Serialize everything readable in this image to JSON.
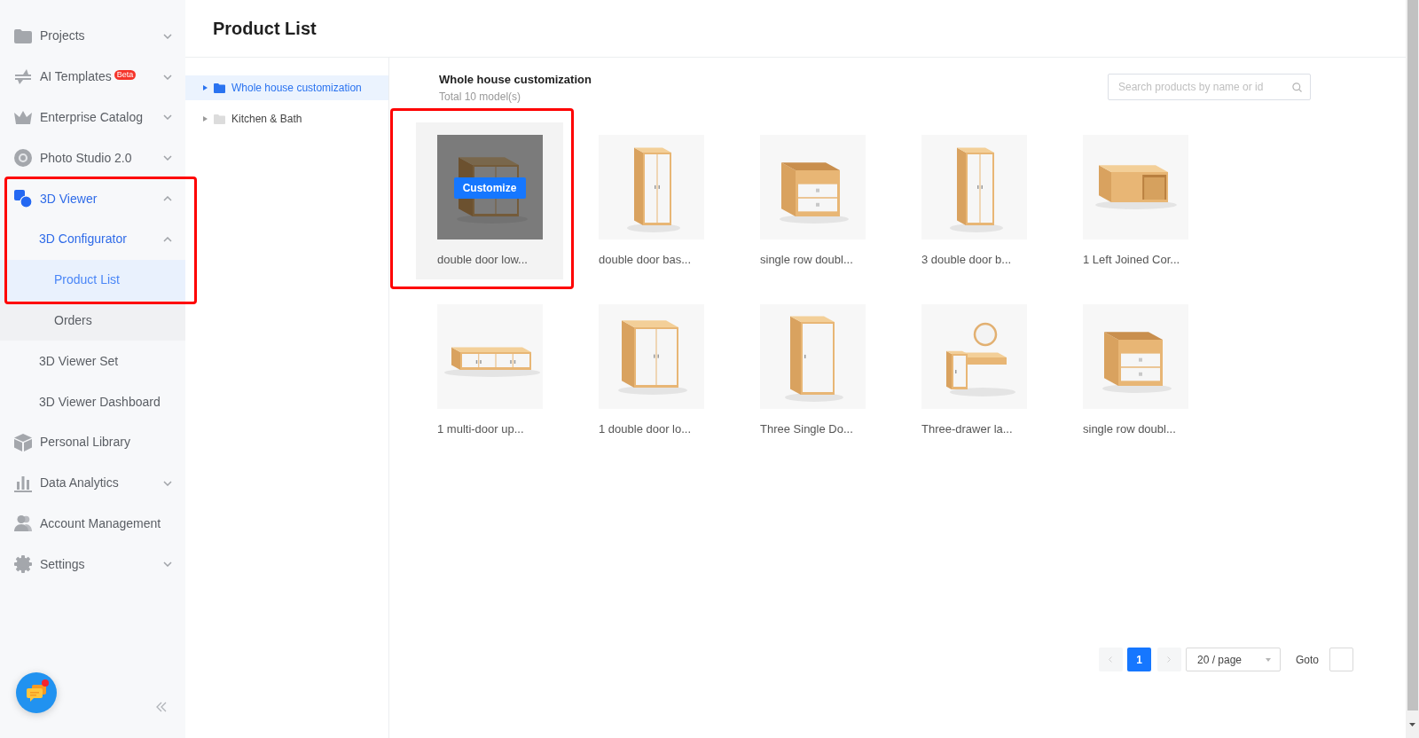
{
  "sidebar": {
    "items": [
      {
        "label": "Projects",
        "expanded": false,
        "selected": false,
        "annotated": false
      },
      {
        "label": "AI Templates",
        "badge": "Beta",
        "expanded": false,
        "selected": false,
        "annotated": false
      },
      {
        "label": "Enterprise Catalog",
        "expanded": false,
        "selected": false,
        "annotated": false
      },
      {
        "label": "Photo Studio 2.0",
        "expanded": false,
        "selected": false,
        "annotated": false
      },
      {
        "label": "3D Viewer",
        "expanded": true,
        "selected": false,
        "annotated": true,
        "children": [
          {
            "label": "3D Configurator",
            "expanded": true,
            "selected": false,
            "annotated": true,
            "children": [
              {
                "label": "Product List",
                "selected": true,
                "annotated": true
              },
              {
                "label": "Orders",
                "selected": false,
                "annotated": false
              }
            ]
          },
          {
            "label": "3D Viewer Set",
            "selected": false,
            "annotated": false
          },
          {
            "label": "3D Viewer Dashboard",
            "selected": false,
            "annotated": false
          }
        ]
      },
      {
        "label": "Personal Library",
        "selected": false,
        "annotated": false
      },
      {
        "label": "Data Analytics",
        "expanded": false,
        "selected": false,
        "annotated": false
      },
      {
        "label": "Account Management",
        "selected": false,
        "annotated": false
      },
      {
        "label": "Settings",
        "expanded": false,
        "selected": false,
        "annotated": false
      }
    ]
  },
  "header": {
    "title": "Product List"
  },
  "category_tree": [
    {
      "label": "Whole house customization",
      "selected": true
    },
    {
      "label": "Kitchen & Bath",
      "selected": false
    }
  ],
  "products": {
    "title": "Whole house customization",
    "count": "Total 10 model(s)",
    "search": {
      "placeholder": "Search products by name or id"
    },
    "items": [
      {
        "name": "double door low...",
        "hovered": true,
        "annotated": true,
        "action": "Customize"
      },
      {
        "name": "double door bas...",
        "hovered": false,
        "annotated": false
      },
      {
        "name": "single row doubl...",
        "hovered": false,
        "annotated": false
      },
      {
        "name": "3 double door b...",
        "hovered": false,
        "annotated": false
      },
      {
        "name": "1 Left Joined Cor...",
        "hovered": false,
        "annotated": false
      },
      {
        "name": "1 multi-door up...",
        "hovered": false,
        "annotated": false
      },
      {
        "name": "1 double door lo...",
        "hovered": false,
        "annotated": false
      },
      {
        "name": "Three Single Do...",
        "hovered": false,
        "annotated": false
      },
      {
        "name": "Three-drawer la...",
        "hovered": false,
        "annotated": false
      },
      {
        "name": "single row doubl...",
        "hovered": false,
        "annotated": false
      }
    ]
  },
  "pagination": {
    "prev_disabled": true,
    "pages": [
      {
        "label": "1",
        "selected": true
      }
    ],
    "next_disabled": true,
    "page_size": "20 / page",
    "goto_label": "Goto"
  }
}
